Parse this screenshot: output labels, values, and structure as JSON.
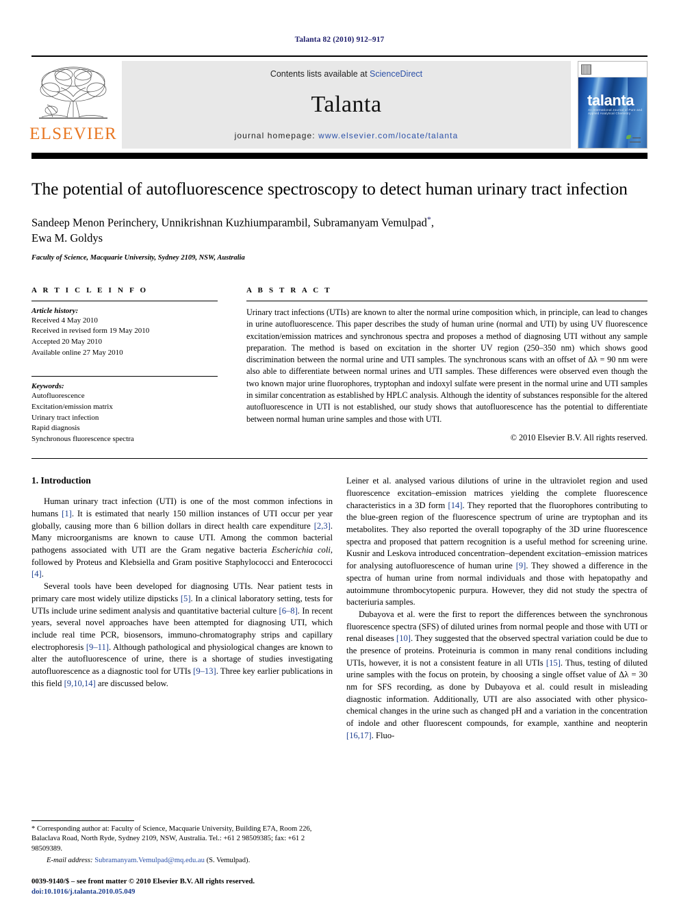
{
  "running_head": "Talanta 82 (2010) 912–917",
  "masthead": {
    "publisher_name": "ELSEVIER",
    "contents_prefix": "Contents lists available at ",
    "sciencedirect": "ScienceDirect",
    "journal_name": "Talanta",
    "homepage_prefix": "journal homepage: ",
    "homepage_url": "www.elsevier.com/locate/talanta",
    "cover_title": "talanta",
    "cover_subtitle": "An International Journal of Pure and Applied Analytical Chemistry",
    "link_color": "#2b50a8",
    "elsevier_orange": "#E87722"
  },
  "title": "The potential of autofluorescence spectroscopy to detect human urinary tract infection",
  "authors": "Sandeep Menon Perinchery, Unnikrishnan Kuzhiumparambil, Subramanyam Vemulpad",
  "authors_line2": "Ewa M. Goldys",
  "corresponding_marker": "*",
  "affiliation": "Faculty of Science, Macquarie University, Sydney 2109, NSW, Australia",
  "article_info": {
    "heading": "A R T I C L E    I N F O",
    "history_label": "Article history:",
    "history": [
      "Received 4 May 2010",
      "Received in revised form 19 May 2010",
      "Accepted 20 May 2010",
      "Available online 27 May 2010"
    ],
    "keywords_label": "Keywords:",
    "keywords": [
      "Autofluorescence",
      "Excitation/emission matrix",
      "Urinary tract infection",
      "Rapid diagnosis",
      "Synchronous fluorescence spectra"
    ]
  },
  "abstract": {
    "heading": "A B S T R A C T",
    "text": "Urinary tract infections (UTIs) are known to alter the normal urine composition which, in principle, can lead to changes in urine autofluorescence. This paper describes the study of human urine (normal and UTI) by using UV fluorescence excitation/emission matrices and synchronous spectra and proposes a method of diagnosing UTI without any sample preparation. The method is based on excitation in the shorter UV region (250–350 nm) which shows good discrimination between the normal urine and UTI samples. The synchronous scans with an offset of Δλ = 90 nm were also able to differentiate between normal urines and UTI samples. These differences were observed even though the two known major urine fluorophores, tryptophan and indoxyl sulfate were present in the normal urine and UTI samples in similar concentration as established by HPLC analysis. Although the identity of substances responsible for the altered autofluorescence in UTI is not established, our study shows that autofluorescence has the potential to differentiate between normal human urine samples and those with UTI.",
    "copyright": "© 2010 Elsevier B.V. All rights reserved."
  },
  "introduction": {
    "heading": "1.  Introduction",
    "left_p1": "Human urinary tract infection (UTI) is one of the most common infections in humans [1]. It is estimated that nearly 150 million instances of UTI occur per year globally, causing more than 6 billion dollars in direct health care expenditure [2,3]. Many microorganisms are known to cause UTI. Among the common bacterial pathogens associated with UTI are the Gram negative bacteria Escherichia coli, followed by Proteus and Klebsiella and Gram positive Staphylococci and Enterococci [4].",
    "left_p2": "Several tools have been developed for diagnosing UTIs. Near patient tests in primary care most widely utilize dipsticks [5]. In a clinical laboratory setting, tests for UTIs include urine sediment analysis and quantitative bacterial culture [6–8]. In recent years, several novel approaches have been attempted for diagnosing UTI, which include real time PCR, biosensors, immuno-chromatography strips and capillary electrophoresis [9–11]. Although pathological and physiological changes are known to alter the autofluorescence of urine, there is a shortage of studies investigating autofluorescence as a diagnostic tool for UTIs [9–13]. Three key earlier publications in this field [9,10,14] are discussed below.",
    "right_p1": "Leiner et al. analysed various dilutions of urine in the ultraviolet region and used fluorescence excitation–emission matrices yielding the complete fluorescence characteristics in a 3D form [14]. They reported that the fluorophores contributing to the blue-green region of the fluorescence spectrum of urine are tryptophan and its metabolites. They also reported the overall topography of the 3D urine fluorescence spectra and proposed that pattern recognition is a useful method for screening urine. Kusnir and Leskova introduced concentration–dependent excitation–emission matrices for analysing autofluorescence of human urine [9]. They showed a difference in the spectra of human urine from normal individuals and those with hepatopathy and autoimmune thrombocytopenic purpura. However, they did not study the spectra of bacteriuria samples.",
    "right_p2": "Dubayova et al. were the first to report the differences between the synchronous fluorescence spectra (SFS) of diluted urines from normal people and those with UTI or renal diseases [10]. They suggested that the observed spectral variation could be due to the presence of proteins. Proteinuria is common in many renal conditions including UTIs, however, it is not a consistent feature in all UTIs [15]. Thus, testing of diluted urine samples with the focus on protein, by choosing a single offset value of Δλ = 30 nm for SFS recording, as done by Dubayova et al. could result in misleading diagnostic information. Additionally, UTI are also associated with other physico-chemical changes in the urine such as changed pH and a variation in the concentration of indole and other fluorescent compounds, for example, xanthine and neopterin [16,17]. Fluo-"
  },
  "footnotes": {
    "corresponding": "* Corresponding author at: Faculty of Science, Macquarie University, Building E7A, Room 226, Balaclava Road, North Ryde, Sydney 2109, NSW, Australia. Tel.: +61 2 98509385; fax: +61 2 98509389.",
    "email_label": "E-mail address:",
    "email": "Subramanyam.Vemulpad@mq.edu.au",
    "email_owner": "(S. Vemulpad).",
    "imprint": "0039-9140/$ – see front matter © 2010 Elsevier B.V. All rights reserved.",
    "doi": "doi:10.1016/j.talanta.2010.05.049"
  }
}
